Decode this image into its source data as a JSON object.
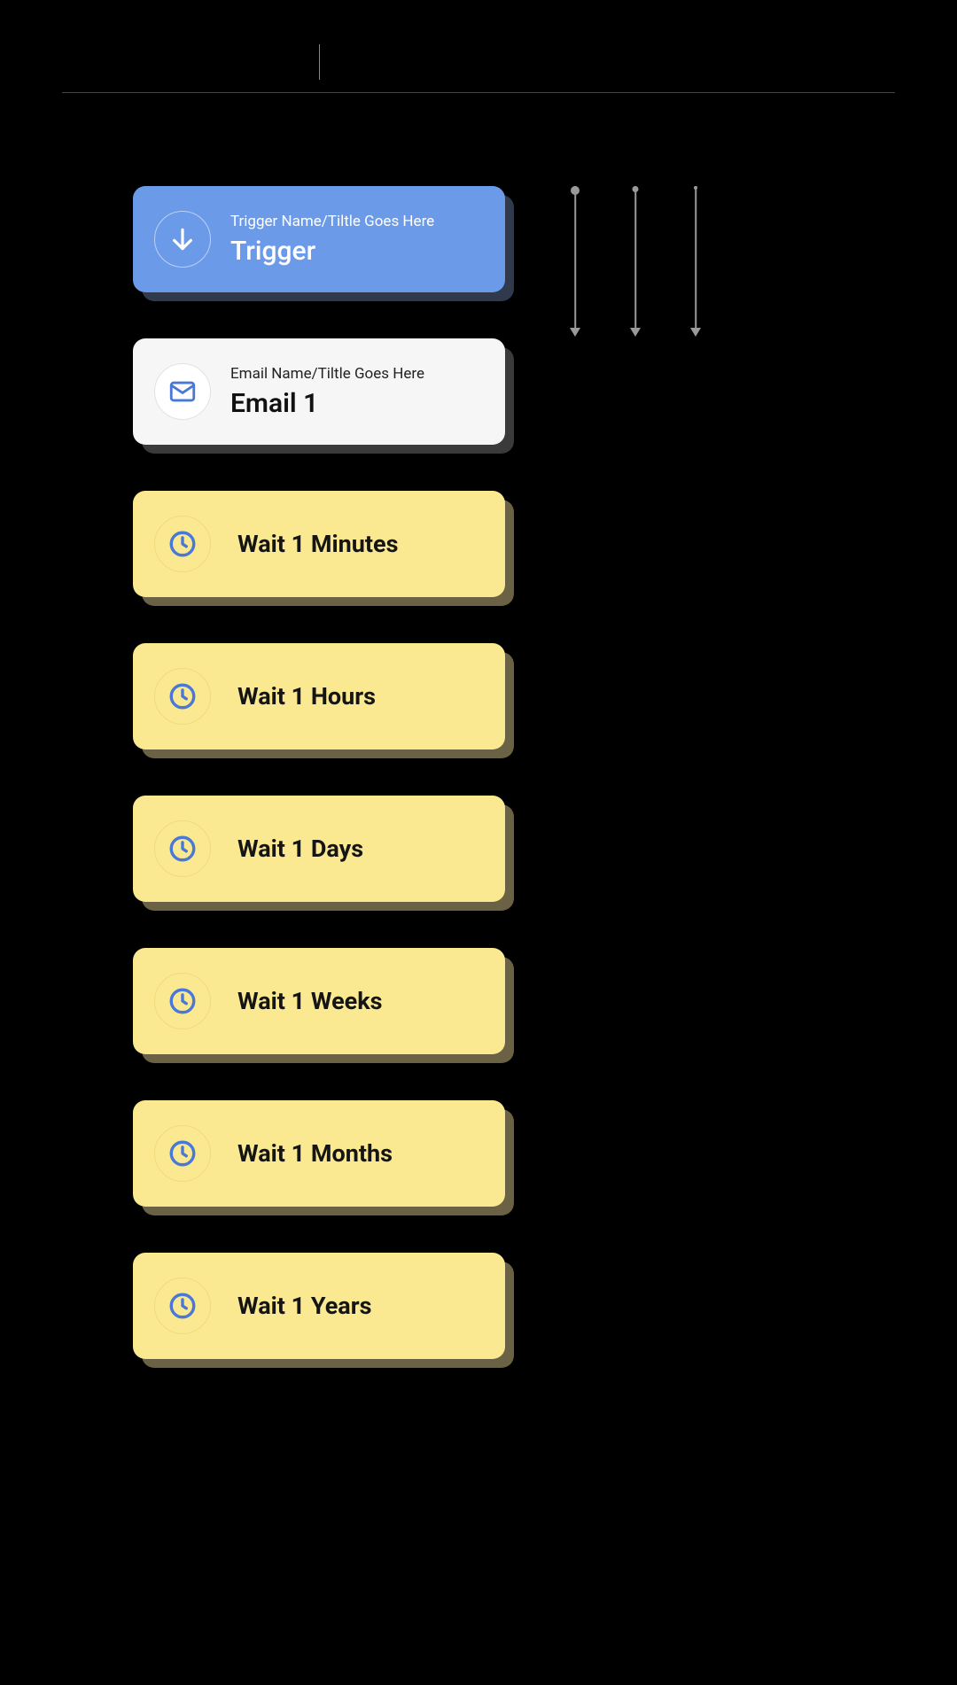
{
  "trigger": {
    "subtitle": "Trigger Name/Tiltle Goes Here",
    "title": "Trigger"
  },
  "email": {
    "subtitle": "Email Name/Tiltle Goes Here",
    "title": "Email 1"
  },
  "wait": {
    "prefix": "Wait",
    "amount": "1",
    "units": {
      "minutes": "Minutes",
      "hours": "Hours",
      "days": "Days",
      "weeks": "Weeks",
      "months": "Months",
      "years": "Years"
    }
  },
  "connectors": [
    {
      "dot_size": 10,
      "length": 160
    },
    {
      "dot_size": 7,
      "length": 160
    },
    {
      "dot_size": 4,
      "length": 160
    }
  ],
  "colors": {
    "trigger_bg": "#6b9ae8",
    "email_bg": "#f6f6f6",
    "wait_bg": "#fbe991",
    "accent_blue": "#4a78d8"
  }
}
